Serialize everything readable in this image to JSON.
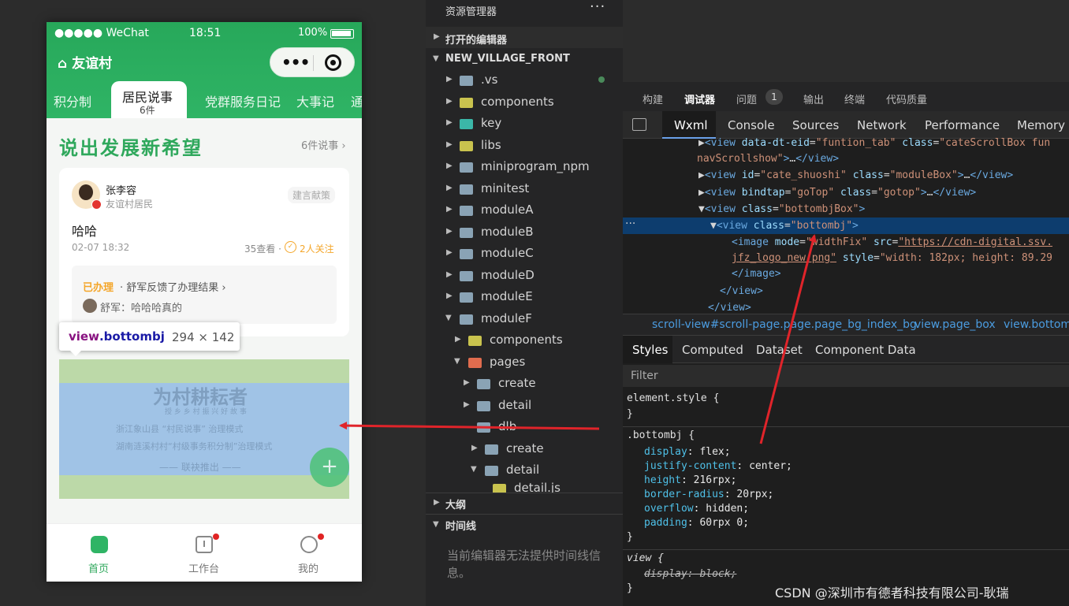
{
  "phone": {
    "status": {
      "carrier": "●●●●● WeChat",
      "time": "18:51",
      "battery": "100%"
    },
    "title": "友谊村",
    "tabs": [
      {
        "label": "积分制"
      },
      {
        "label": "居民说事",
        "count": "6件"
      },
      {
        "label": "党群服务日记"
      },
      {
        "label": "大事记"
      },
      {
        "label": "通"
      }
    ],
    "slogan": "说出发展新希望",
    "count_link": "6件说事 ›",
    "post": {
      "user_name": "张李容",
      "user_role": "友谊村居民",
      "tag": "建言献策",
      "text": "哈哈",
      "date": "02-07 18:32",
      "views": "35查看 ·",
      "follow_icon": "✓",
      "follow": "2人关注",
      "reply_status": "已办理",
      "reply_desc": "· 舒军反馈了办理结果 ›",
      "reply_text": "舒军：哈哈哈真的"
    },
    "inspect": {
      "tag": "view",
      "cls": ".bottombj",
      "size": "294 × 142"
    },
    "watermark": {
      "title": "为村耕耘者",
      "sub": "授 乡 乡 村 振 兴 好 故 事",
      "line1": "浙江象山县 “村民说事” 治理模式",
      "line2": "湖南涟溪村村“村级事务积分制”治理模式",
      "line3": "—— 联袂推出 ——"
    },
    "fab": "+",
    "tabbar": [
      {
        "label": "首页"
      },
      {
        "label": "工作台"
      },
      {
        "label": "我的"
      }
    ]
  },
  "explorer": {
    "title": "资源管理器",
    "more": "···",
    "open_editors": "打开的编辑器",
    "project": "NEW_VILLAGE_FRONT",
    "tree": [
      ".vs",
      "components",
      "key",
      "libs",
      "miniprogram_npm",
      "minitest",
      "moduleA",
      "moduleB",
      "moduleC",
      "moduleD",
      "moduleE",
      "moduleF",
      "components",
      "pages",
      "create",
      "detail",
      "dlb",
      "create",
      "detail",
      "detail.js"
    ],
    "outline": "大纲",
    "timeline": "时间线",
    "timeline_msg": "当前编辑器无法提供时间线信息。"
  },
  "devtools": {
    "top_tabs": [
      "构建",
      "调试器",
      "问题",
      "输出",
      "终端",
      "代码质量"
    ],
    "problems_count": "1",
    "panel_tabs": [
      "Wxml",
      "Console",
      "Sources",
      "Network",
      "Performance",
      "Memory"
    ],
    "breadcrumb": [
      "scroll-view#scroll-page.page.page_bg_index_bg",
      "view.page_box",
      "view.bottom"
    ],
    "styles_tabs": [
      "Styles",
      "Computed",
      "Dataset",
      "Component Data"
    ],
    "filter_placeholder": "Filter",
    "css": {
      "element_style": "element.style {",
      "close": "}",
      "bottombj_sel": ".bottombj {",
      "props": [
        {
          "name": "display",
          "value": "flex;"
        },
        {
          "name": "justify-content",
          "value": "center;"
        },
        {
          "name": "height",
          "value": "216rpx;"
        },
        {
          "name": "border-radius",
          "value": "20rpx;"
        },
        {
          "name": "overflow",
          "value": "hidden;"
        },
        {
          "name": "padding",
          "value": "60rpx 0;"
        }
      ],
      "view_sel": "view {",
      "view_prop": "display: block;"
    }
  },
  "watermark_credit": "CSDN @深圳市有德者科技有限公司-耿瑞"
}
